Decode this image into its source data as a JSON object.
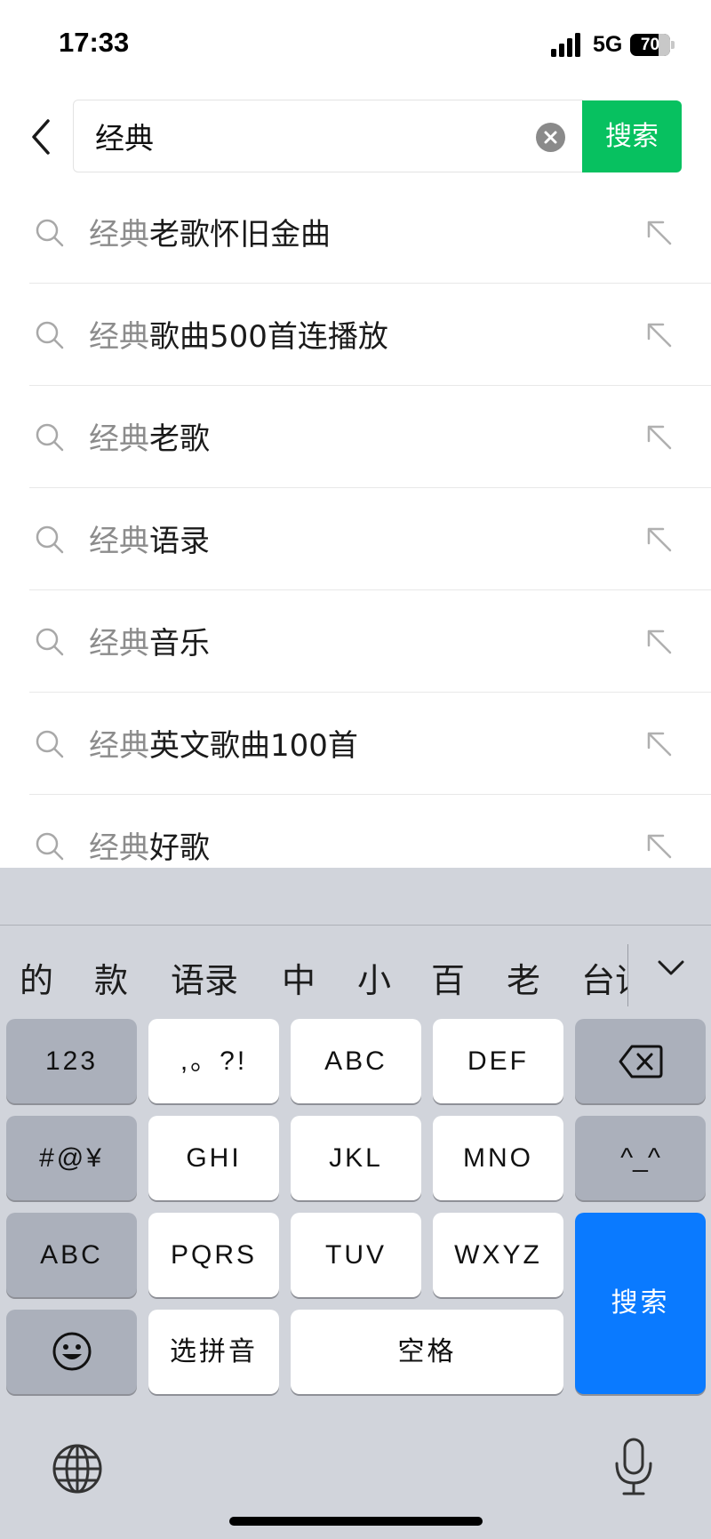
{
  "status_bar": {
    "time": "17:33",
    "network": "5G",
    "battery_level": "70",
    "battery_fraction": 0.7
  },
  "search": {
    "query": "经典",
    "button_label": "搜索"
  },
  "suggestions": [
    {
      "match": "经典",
      "rest": "老歌怀旧金曲"
    },
    {
      "match": "经典",
      "rest": "歌曲500首连播放"
    },
    {
      "match": "经典",
      "rest": "老歌"
    },
    {
      "match": "经典",
      "rest": "语录"
    },
    {
      "match": "经典",
      "rest": "音乐"
    },
    {
      "match": "经典",
      "rest": "英文歌曲100首"
    },
    {
      "match": "经典",
      "rest": "好歌"
    }
  ],
  "keyboard": {
    "candidates": [
      "的",
      "款",
      "语录",
      "中",
      "小",
      "百",
      "老",
      "台词"
    ],
    "rows": [
      [
        "123",
        ",。?!",
        "ABC",
        "DEF"
      ],
      [
        "#@¥",
        "GHI",
        "JKL",
        "MNO",
        "^_^"
      ],
      [
        "ABC",
        "PQRS",
        "TUV",
        "WXYZ"
      ],
      [
        "选拼音",
        "空格"
      ]
    ],
    "search_key": "搜索"
  },
  "colors": {
    "accent_green": "#07c160",
    "keyboard_blue": "#0a7aff",
    "match_grey": "#8c8c8c"
  }
}
